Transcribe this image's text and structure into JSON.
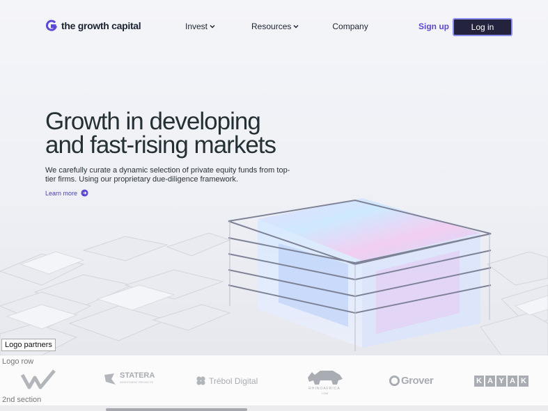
{
  "nav": {
    "brand": "the growth capital",
    "links": [
      {
        "label": "Invest",
        "dropdown": true
      },
      {
        "label": "Resources",
        "dropdown": true
      },
      {
        "label": "Company",
        "dropdown": false
      }
    ],
    "signup_label": "Sign up",
    "login_label": "Log in"
  },
  "hero": {
    "title_line1": "Growth in developing",
    "title_line2": "and fast-rising markets",
    "subtitle": "We carefully curate a dynamic selection of private equity funds from top-tier firms. Using our proprietary due-diligence framework.",
    "learn_more": "Learn more"
  },
  "overlays": {
    "logo_partners": "Logo partners",
    "logo_row": "Logo row",
    "second_section": "2nd section"
  },
  "partners": [
    {
      "name": "",
      "icon": "w-mark-icon"
    },
    {
      "name": "STATERA",
      "tagline": "INVESTMENT PROJECTS",
      "icon": "statera-icon"
    },
    {
      "name": "Trébol Digital",
      "icon": "clover-icon"
    },
    {
      "name": "RHINOAFRICA",
      "tagline": ".COM",
      "icon": "rhino-icon"
    },
    {
      "name": "Grover",
      "icon": "grover-g-icon"
    },
    {
      "name": "KAYAK",
      "icon": "kayak-icon"
    }
  ],
  "colors": {
    "accent": "#5a48d6",
    "button_dark": "#24233d",
    "heading": "#243036"
  }
}
